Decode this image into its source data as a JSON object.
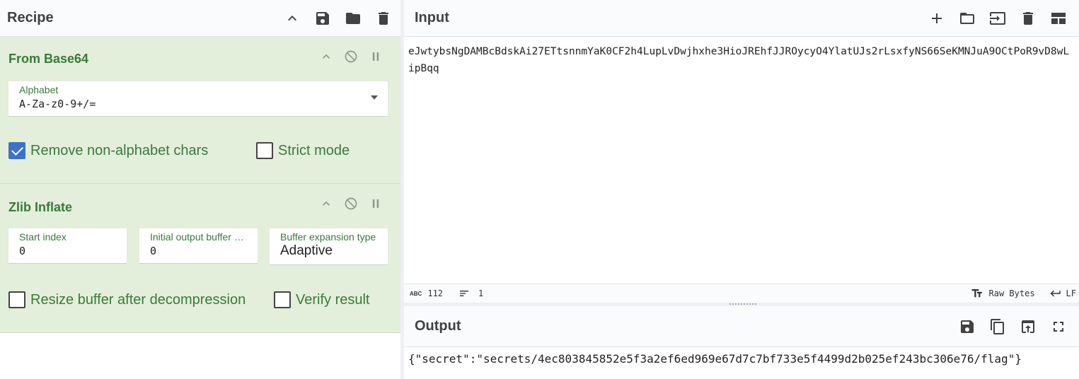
{
  "recipe": {
    "title": "Recipe",
    "operations": [
      {
        "title": "From Base64",
        "alphabet_label": "Alphabet",
        "alphabet_value": "A-Za-z0-9+/=",
        "remove_non_alphabet_label": "Remove non-alphabet chars",
        "remove_non_alphabet_checked": true,
        "strict_mode_label": "Strict mode",
        "strict_mode_checked": false
      },
      {
        "title": "Zlib Inflate",
        "start_index_label": "Start index",
        "start_index_value": "0",
        "initial_buffer_label": "Initial output buffer s...",
        "initial_buffer_value": "0",
        "expansion_type_label": "Buffer expansion type",
        "expansion_type_value": "Adaptive",
        "resize_label": "Resize buffer after decompression",
        "resize_checked": false,
        "verify_label": "Verify result",
        "verify_checked": false
      }
    ]
  },
  "input": {
    "title": "Input",
    "text": "eJwtybsNgDAMBcBdskAi27ETtsnnmYaK0CF2h4LupLvDwjhxhe3HioJREhfJJROycyO4YlatUJs2rLsxfyNS66SeKMNJuA9OCtPoR9vD8wLipBqq",
    "status": {
      "char_count": "112",
      "line_count": "1",
      "encoding": "Raw Bytes",
      "eol": "LF"
    }
  },
  "output": {
    "title": "Output",
    "text": "{\"secret\":\"secrets/4ec803845852e5f3a2ef6ed969e67d7c7bf733e5f4499d2b025ef243bc306e76/flag\"}"
  },
  "colors": {
    "op_background": "#e3eedb",
    "op_text": "#3a7a3a",
    "checkbox_on": "#3b73c8"
  }
}
